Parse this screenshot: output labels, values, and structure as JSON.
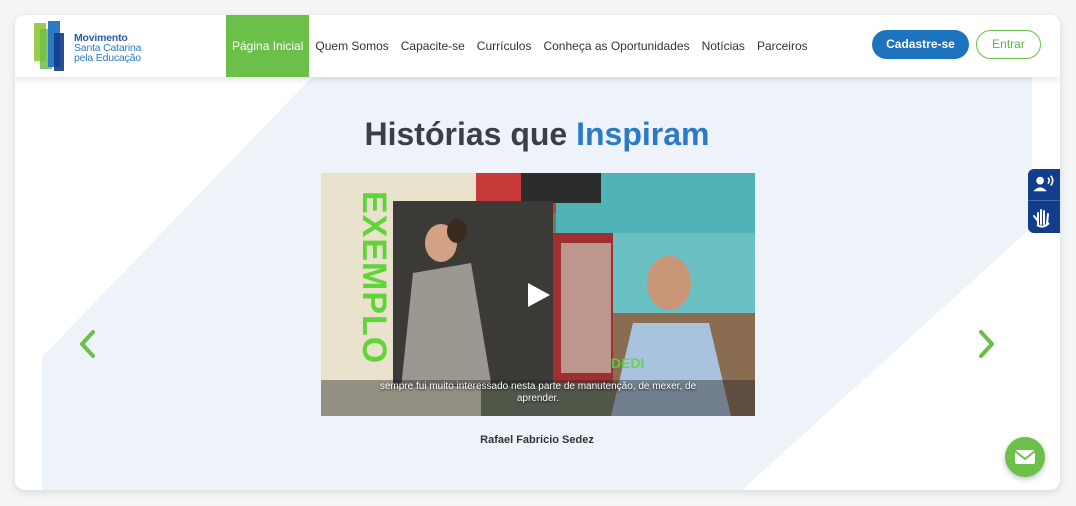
{
  "header": {
    "logo": {
      "line1": "Movimento",
      "line2": "Santa Catarina",
      "line3": "pela Educação"
    },
    "nav": [
      {
        "label": "Página Inicial",
        "active": true
      },
      {
        "label": "Quem Somos",
        "active": false
      },
      {
        "label": "Capacite-se",
        "active": false
      },
      {
        "label": "Currículos",
        "active": false
      },
      {
        "label": "Conheça as Oportunidades",
        "active": false
      },
      {
        "label": "Notícias",
        "active": false
      },
      {
        "label": "Parceiros",
        "active": false
      }
    ],
    "register_label": "Cadastre-se",
    "login_label": "Entrar"
  },
  "hero": {
    "title_plain": "Histórias que",
    "title_highlight": "Inspiram",
    "video": {
      "overlay_word": "EXEMPLO",
      "subtitle": "sempre fui muito interessado nesta parte de manutenção, de mexer, de aprender."
    },
    "caption": "Rafael Fabricio Sedez"
  },
  "icons": {
    "play": "play-icon",
    "prev": "chevron-left-icon",
    "next": "chevron-right-icon",
    "audio": "audio-description-icon",
    "sign_language": "sign-language-icon",
    "message": "envelope-icon"
  },
  "colors": {
    "brand_green": "#6cc04a",
    "brand_blue": "#1e73be",
    "title_blue": "#2a7bc4",
    "a11y_blue": "#123d8b",
    "hero_bg": "#eef2f9"
  }
}
